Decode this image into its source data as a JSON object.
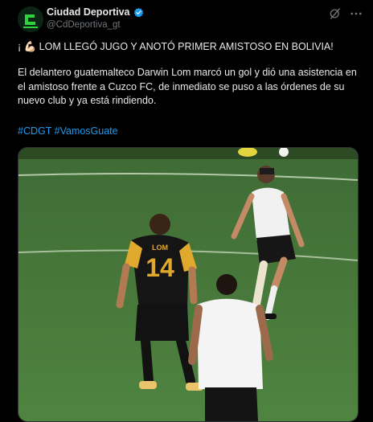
{
  "tweet": {
    "author_name": "Ciudad Deportiva",
    "handle": "@CdDeportiva_gt",
    "headline": "¡ 💪🏻 LOM LLEGÓ JUGO Y ANOTÓ PRIMER AMISTOSO EN BOLIVIA!",
    "body": "El delantero guatemalteco Darwin Lom marcó un gol y dió una asistencia en el amistoso frente a Cuzco FC, de inmediato se puso a las órdenes de su nuevo club y ya está rindiendo.",
    "hashtags": "#CDGT #VamosGuate",
    "media": {
      "jersey_name": "LOM",
      "jersey_number": "14"
    }
  },
  "icons": {
    "avatar": "ciudad-deportiva-logo",
    "verified": "verified-badge-icon",
    "grok": "grok-icon",
    "more": "more-options-icon"
  },
  "colors": {
    "accent": "#1d9bf0",
    "background": "#000000",
    "text": "#e7e9ea",
    "muted": "#71767b"
  }
}
